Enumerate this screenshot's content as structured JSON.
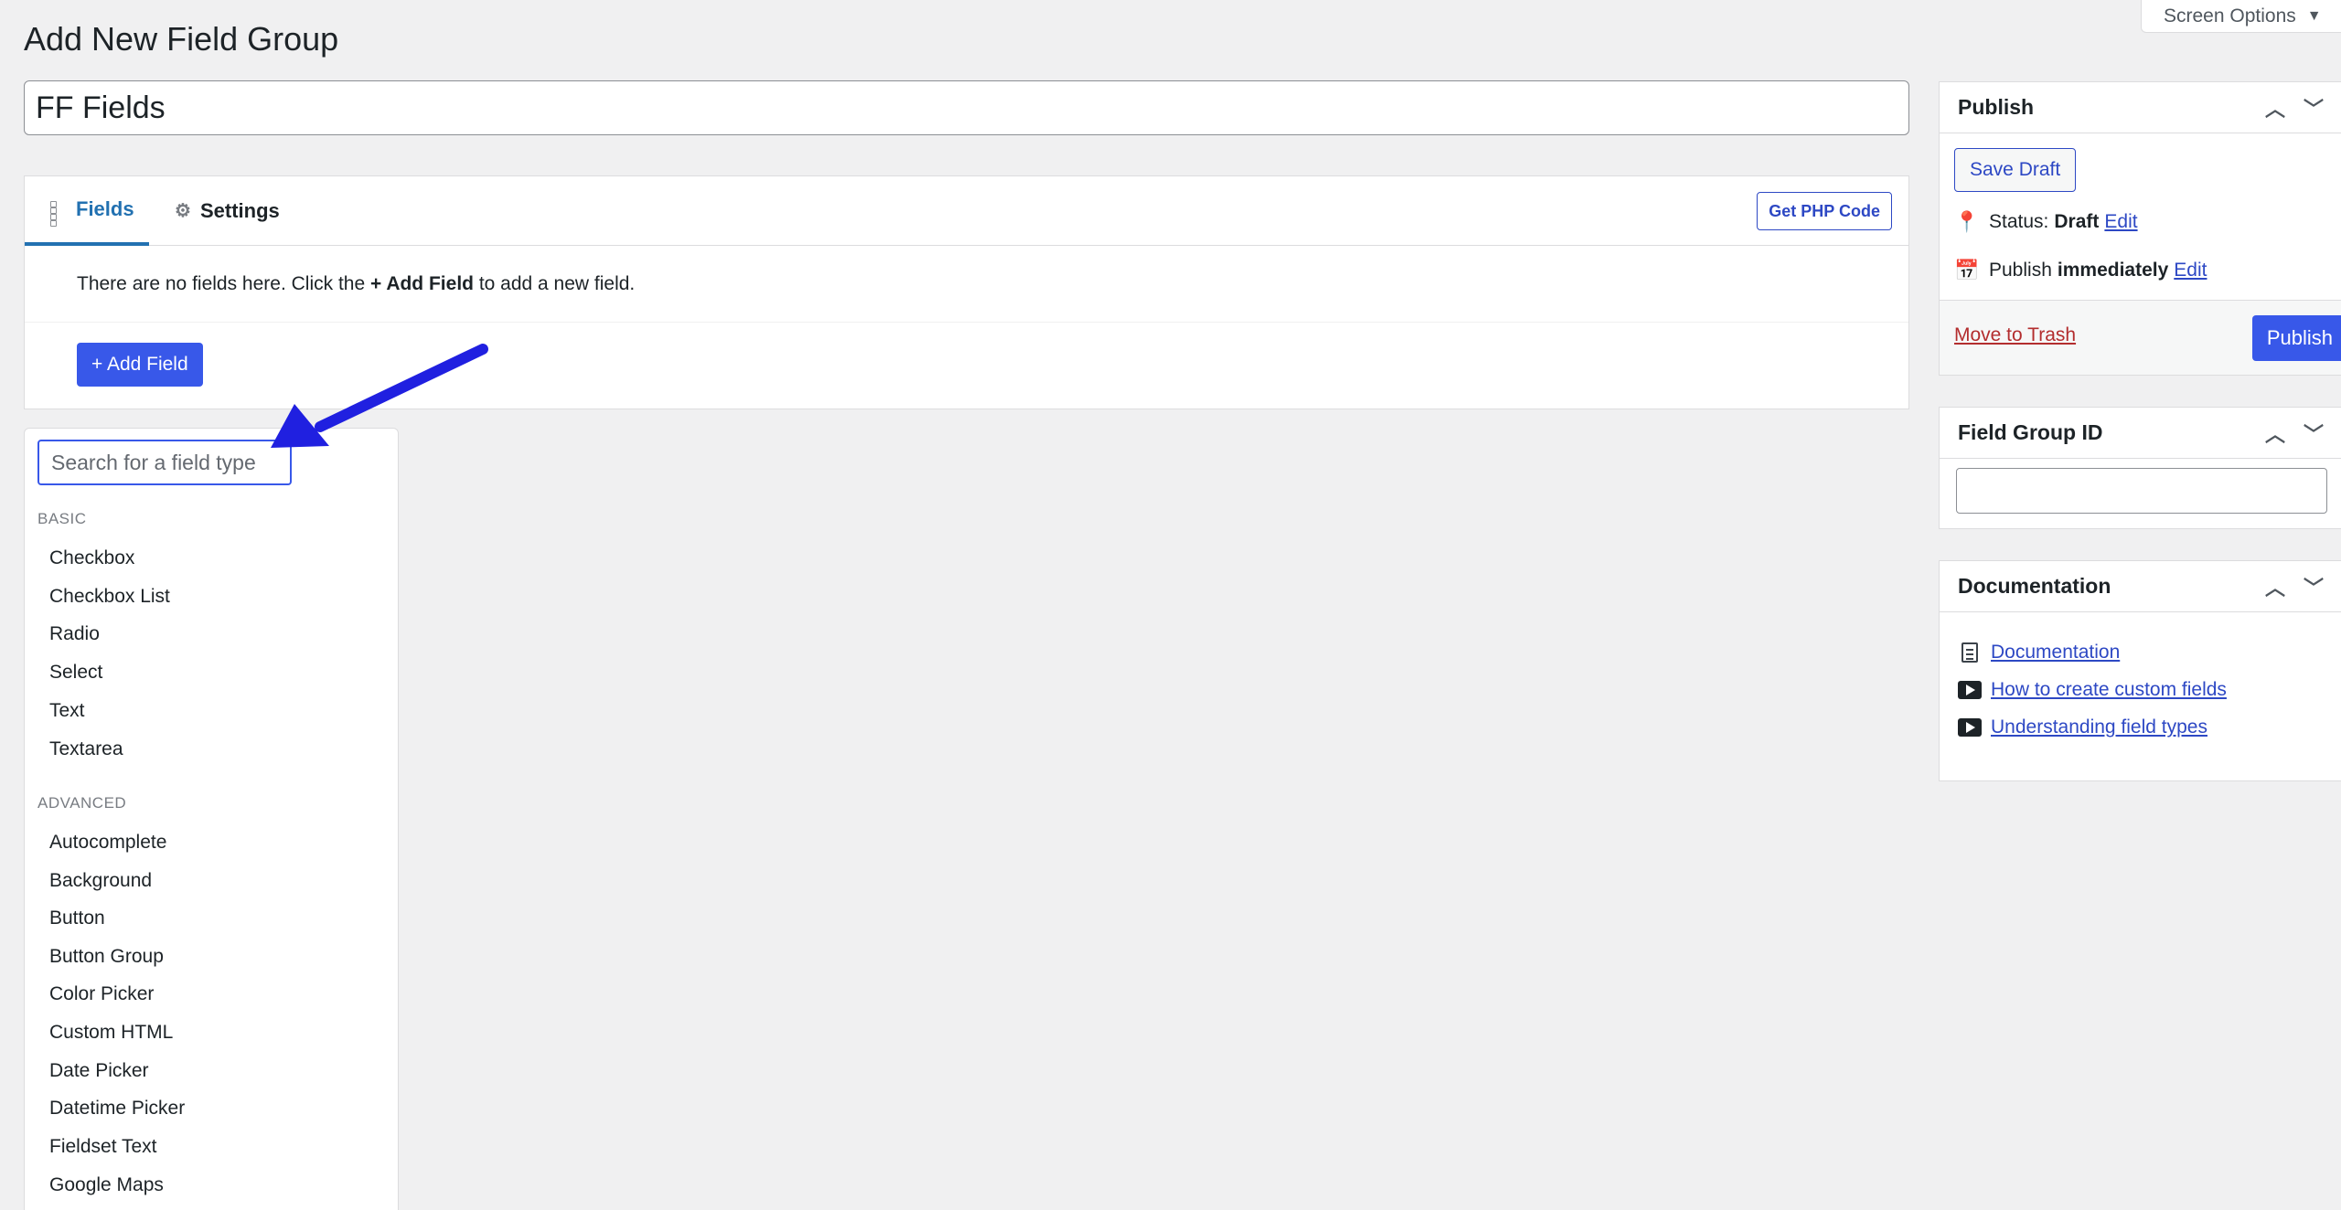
{
  "screen_options": {
    "label": "Screen Options",
    "icon": "triangle-down-icon"
  },
  "page_title": "Add New Field Group",
  "title_input": {
    "value": "FF Fields"
  },
  "tabs": [
    {
      "label": "Fields",
      "icon": "grid-icon",
      "active": true
    },
    {
      "label": "Settings",
      "icon": "gear-icon",
      "active": false
    }
  ],
  "get_php_code_label": "Get PHP Code",
  "no_fields": {
    "prefix": "There are no fields here. Click the ",
    "bold": "+ Add Field",
    "suffix": " to add a new field."
  },
  "add_field_label": "+ Add Field",
  "field_type_picker": {
    "search_placeholder": "Search for a field type",
    "groups": [
      {
        "label": "BASIC",
        "items": [
          "Checkbox",
          "Checkbox List",
          "Radio",
          "Select",
          "Text",
          "Textarea"
        ]
      },
      {
        "label": "ADVANCED",
        "items": [
          "Autocomplete",
          "Background",
          "Button",
          "Button Group",
          "Color Picker",
          "Custom HTML",
          "Date Picker",
          "Datetime Picker",
          "Fieldset Text",
          "Google Maps"
        ]
      }
    ]
  },
  "annotation": {
    "color": "#2020e0"
  },
  "publish_box": {
    "title": "Publish",
    "save_draft_label": "Save Draft",
    "status_label": "Status:",
    "status_value": "Draft",
    "edit_label": "Edit",
    "publish_label": "Publish",
    "publish_when": "immediately",
    "edit_label_2": "Edit",
    "move_to_trash_label": "Move to Trash",
    "publish_button_label": "Publish"
  },
  "field_group_id_box": {
    "title": "Field Group ID",
    "value": ""
  },
  "documentation_box": {
    "title": "Documentation",
    "links": [
      {
        "label": "Documentation",
        "icon": "document-icon"
      },
      {
        "label": "How to create custom fields",
        "icon": "video-icon"
      },
      {
        "label": "Understanding field types",
        "icon": "video-icon"
      }
    ]
  },
  "colors": {
    "accent": "#3858e9",
    "tab_active": "#2271b1",
    "trash": "#b32d2e",
    "link": "#2d48c4"
  }
}
